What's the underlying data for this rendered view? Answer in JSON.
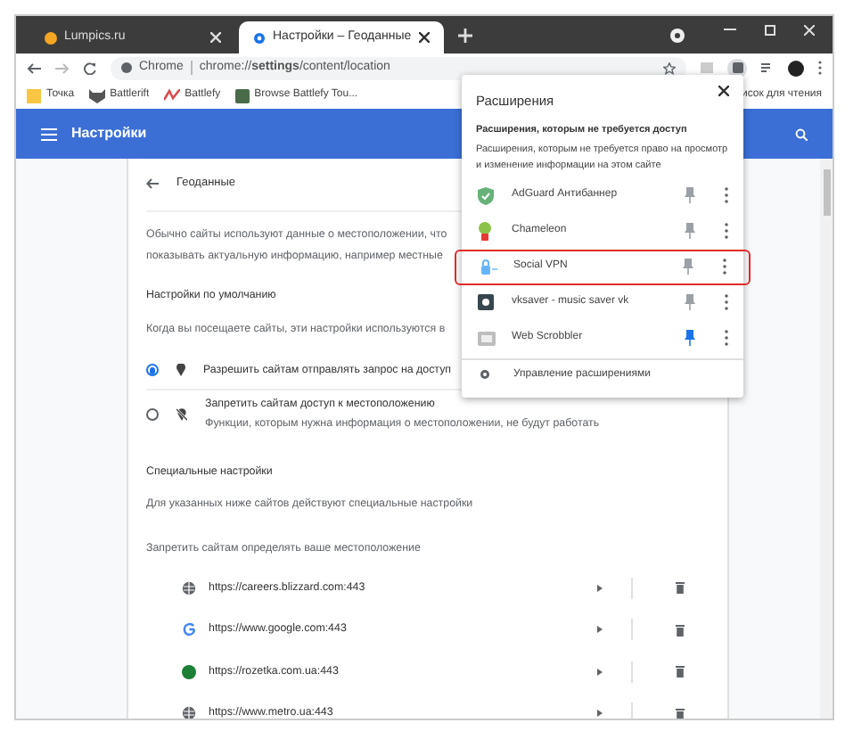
{
  "tabs": [
    {
      "label": "Lumpics.ru",
      "selected": false
    },
    {
      "label": "Настройки – Геоданные",
      "selected": true
    }
  ],
  "address_bar": {
    "site_label": "Chrome",
    "url": "chrome://**settings**/content/location"
  },
  "bookmarks": [
    {
      "label": "Точка",
      "kind": "folder"
    },
    {
      "label": "Battlerift",
      "kind": "game"
    },
    {
      "label": "Battlefy",
      "kind": "logo"
    },
    {
      "label": "Browse Battlefy Tou...",
      "kind": "square"
    }
  ],
  "reading_list": "исок для чтения",
  "header": {
    "title": "Настройки"
  },
  "page": {
    "title": "Геоданные",
    "description": [
      "Обычно сайты используют данные о местоположении, что",
      "показывать актуальную информацию, например местные"
    ],
    "default_heading": "Настройки по умолчанию",
    "default_hint": "Когда вы посещаете сайты, эти настройки используются в",
    "options": [
      {
        "label": "Разрешить сайтам отправлять запрос на доступ",
        "selected": true
      },
      {
        "label": "Запретить сайтам доступ к местоположению",
        "sub": "Функции, которым нужна информация о местоположении, не будут работать",
        "selected": false
      }
    ],
    "special_heading": "Специальные настройки",
    "special_hint": "Для указанных ниже сайтов действуют специальные настройки",
    "block_heading": "Запретить сайтам определять ваше местоположение",
    "sites": [
      {
        "url": "https://careers.blizzard.com:443",
        "kind": "globe"
      },
      {
        "url": "https://www.google.com:443",
        "kind": "google"
      },
      {
        "url": "https://rozetka.com.ua:443",
        "kind": "green"
      },
      {
        "url": "https://www.metro.ua:443",
        "kind": "globe"
      }
    ]
  },
  "extensions_popup": {
    "title": "Расширения",
    "heading": "Расширения, которым не требуется доступ",
    "text": "Расширения, которым не требуется право на просмотр и изменение информации на этом сайте",
    "items": [
      {
        "name": "AdGuard Антибаннер",
        "kind": "shield",
        "pinned": false,
        "highlighted": false
      },
      {
        "name": "Chameleon",
        "kind": "chameleon",
        "pinned": false,
        "highlighted": false
      },
      {
        "name": "Social VPN",
        "kind": "vpn",
        "pinned": false,
        "highlighted": true
      },
      {
        "name": "vksaver - music saver vk",
        "kind": "dark",
        "pinned": false,
        "highlighted": false
      },
      {
        "name": "Web Scrobbler",
        "kind": "grey",
        "pinned": true,
        "highlighted": false
      }
    ],
    "manage": "Управление расширениями"
  }
}
